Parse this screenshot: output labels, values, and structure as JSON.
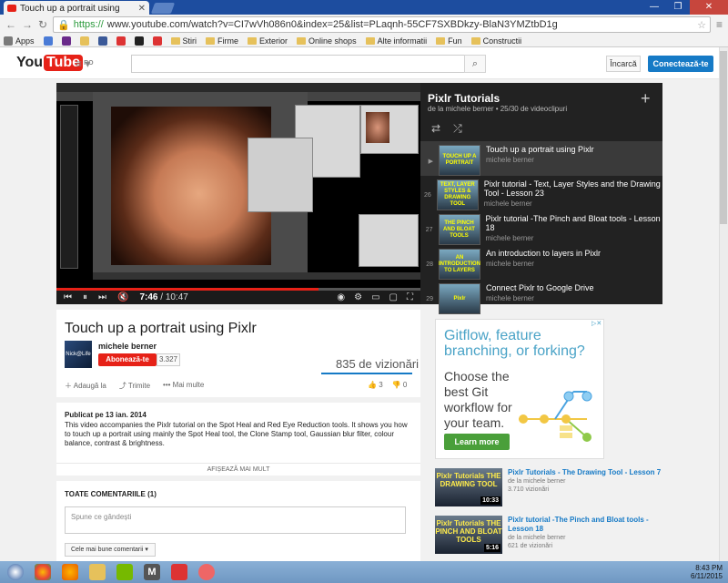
{
  "browser": {
    "tab_title": "Touch up a portrait using",
    "url_scheme": "https://",
    "url_rest": "www.youtube.com/watch?v=CI7wVh086n0&index=25&list=PLaqnh-55CF7SXBDkzy-BlaN3YMZtbD1g",
    "bookmarks": [
      "Apps",
      "Stiri",
      "Firme",
      "Exterior",
      "Online shops",
      "Alte informatii",
      "Fun",
      "Constructii"
    ]
  },
  "header": {
    "logo_you": "You",
    "logo_tube": "Tube",
    "region": "RO",
    "upload_label": "Încarcă",
    "signin_label": "Conectează-te"
  },
  "player": {
    "current_time": "7:46",
    "duration": "10:47",
    "progress_fraction": 0.72
  },
  "playlist": {
    "title": "Pixlr Tutorials",
    "subtitle": "de la michele berner • 25/30 de videoclipuri",
    "items": [
      {
        "index": "▶",
        "title": "Touch up a portrait using Pixlr",
        "author": "michele berner",
        "thumb": "TOUCH UP A PORTRAIT"
      },
      {
        "index": "26",
        "title": "Pixlr tutorial - Text, Layer Styles and the Drawing Tool - Lesson 23",
        "author": "michele berner",
        "thumb": "TEXT, LAYER STYLES & DRAWING TOOL"
      },
      {
        "index": "27",
        "title": "Pixlr tutorial -The Pinch and Bloat tools - Lesson 18",
        "author": "michele berner",
        "thumb": "THE PINCH AND BLOAT TOOLS"
      },
      {
        "index": "28",
        "title": "An introduction to layers in Pixlr",
        "author": "michele berner",
        "thumb": "AN INTRODUCTION TO LAYERS"
      },
      {
        "index": "29",
        "title": "Connect Pixlr to Google Drive",
        "author": "michele berner",
        "thumb": "Pixlr"
      }
    ]
  },
  "video": {
    "title": "Touch up a portrait using Pixlr",
    "channel": "michele berner",
    "subscribe_label": "Abonează-te",
    "subscriber_count": "3.327",
    "views": "835 de vizionări",
    "add_to_label": "Adaugă la",
    "share_label": "Trimite",
    "more_label": "Mai multe",
    "likes": "3",
    "dislikes": "0",
    "published": "Publicat pe 13 ian. 2014",
    "description": "This video accompanies the Pixlr tutorial on the Spot Heal and Red Eye Reduction tools. It shows you how to touch up a portrait using mainly the Spot Heal tool, the Clone Stamp tool, Gaussian blur filter, colour balance, contrast & brightness.",
    "show_more": "AFIȘEAZĂ MAI MULT"
  },
  "comments": {
    "header": "TOATE COMENTARIILE (1)",
    "placeholder": "Spune ce gândești",
    "sort_label": "Cele mai bune comentarii"
  },
  "ad": {
    "headline": "Gitflow, feature branching, or forking?",
    "body": "Choose the best Git workflow for your team.",
    "button": "Learn more"
  },
  "related": [
    {
      "title": "Pixlr Tutorials - The Drawing Tool - Lesson 7",
      "author": "de la michele berner",
      "views": "3.710 vizionări",
      "duration": "10:33",
      "thumb": "Pixlr Tutorials THE DRAWING TOOL"
    },
    {
      "title": "Pixlr tutorial -The Pinch and Bloat tools - Lesson 18",
      "author": "de la michele berner",
      "views": "621 de vizionări",
      "duration": "5:16",
      "thumb": "Pixlr Tutorials THE PINCH AND BLOAT TOOLS"
    }
  ],
  "taskbar": {
    "time": "8:43 PM",
    "date": "6/11/2015"
  },
  "colors": {
    "youtube_red": "#e62117",
    "link_blue": "#167ac6",
    "taskbar": "#7aa2cc"
  }
}
